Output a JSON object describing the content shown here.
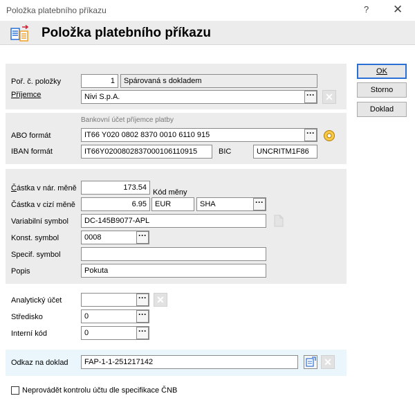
{
  "window": {
    "title": "Položka platebního příkazu",
    "help": "?",
    "close": "✕"
  },
  "header": {
    "title": "Položka platebního příkazu"
  },
  "buttons": {
    "ok": "OK",
    "cancel": "Storno",
    "doc": "Doklad"
  },
  "section1": {
    "por_label": "Poř. č. položky",
    "por_value": "1",
    "status": "Spárovaná s dokladem",
    "payee_label": "Příjemce",
    "payee_value": "Nivi S.p.A."
  },
  "section2": {
    "caption": "Bankovní účet příjemce platby",
    "abo_label": "ABO formát",
    "abo_value": "IT66 Y020 0802 8370 0010 6110 915",
    "iban_label": "IBAN formát",
    "iban_value": "IT66Y0200802837000106110915",
    "bic_label": "BIC",
    "bic_value": "UNCRITM1F86"
  },
  "section3": {
    "amount_home_label": "Částka v nár. měně",
    "amount_home_value": "173.54",
    "currency_code_label": "Kód měny",
    "amount_foreign_label": "Částka v cizí měně",
    "amount_foreign_value": "6.95",
    "currency_value": "EUR",
    "fee_value": "SHA",
    "vs_label": "Variabilní symbol",
    "vs_value": "DC-145B9077-APL",
    "ks_label": "Konst. symbol",
    "ks_value": "0008",
    "ss_label": "Specif. symbol",
    "ss_value": "",
    "desc_label": "Popis",
    "desc_value": "Pokuta"
  },
  "section4": {
    "analytic_label": "Analytický účet",
    "analytic_value": "",
    "center_label": "Středisko",
    "center_value": "0",
    "internal_label": "Interní kód",
    "internal_value": "0"
  },
  "section5": {
    "link_label": "Odkaz na doklad",
    "link_value": "FAP-1-1-251217142"
  },
  "footer": {
    "checkbox_label": "Neprovádět kontrolu účtu dle specifikace ČNB"
  }
}
